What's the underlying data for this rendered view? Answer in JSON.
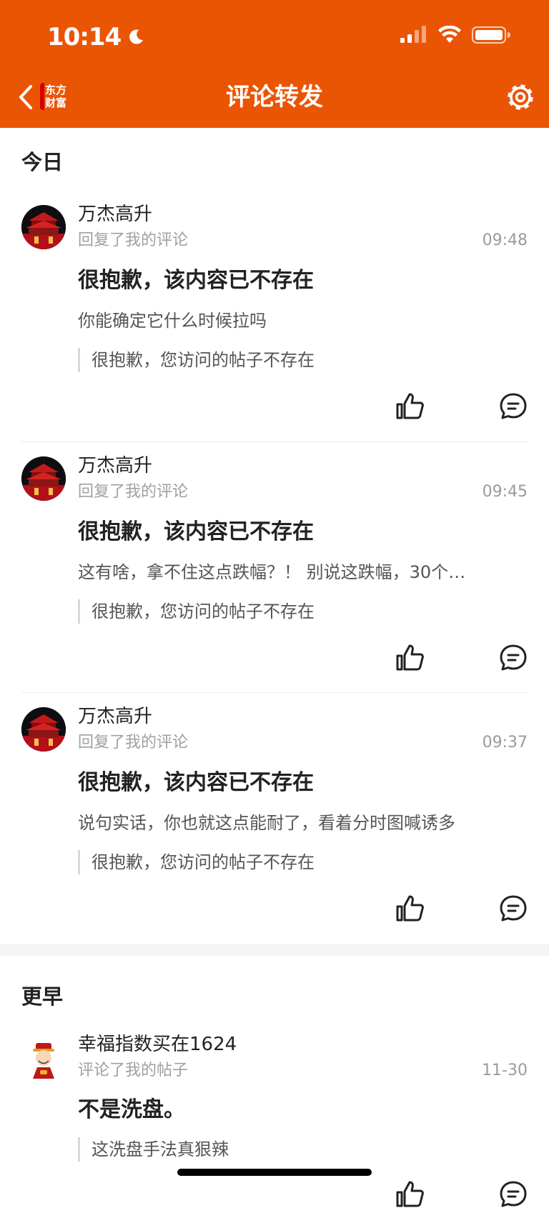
{
  "status_bar": {
    "time": "10:14"
  },
  "nav": {
    "title": "评论转发",
    "logo_line1": "东方",
    "logo_line2": "财富"
  },
  "sections": {
    "today_label": "今日",
    "earlier_label": "更早"
  },
  "today": [
    {
      "username": "万杰高升",
      "action": "回复了我的评论",
      "time": "09:48",
      "headline": "很抱歉，该内容已不存在",
      "reply": "你能确定它什么时候拉吗",
      "quote": "很抱歉，您访问的帖子不存在"
    },
    {
      "username": "万杰高升",
      "action": "回复了我的评论",
      "time": "09:45",
      "headline": "很抱歉，该内容已不存在",
      "reply": "这有啥，拿不住这点跌幅？！ 别说这跌幅，30个…",
      "quote": "很抱歉，您访问的帖子不存在"
    },
    {
      "username": "万杰高升",
      "action": "回复了我的评论",
      "time": "09:37",
      "headline": "很抱歉，该内容已不存在",
      "reply": "说句实话，你也就这点能耐了，看着分时图喊诱多",
      "quote": "很抱歉，您访问的帖子不存在"
    }
  ],
  "earlier": [
    {
      "username": "幸福指数买在1624",
      "action": "评论了我的帖子",
      "time": "11-30",
      "headline": "不是洗盘。",
      "quote": "这洗盘手法真狠辣"
    }
  ],
  "colors": {
    "brand": "#ea5504",
    "secondary_text": "#a0a0a0",
    "quote_bar": "#d8d8d8"
  },
  "icons": [
    "back-chevron-icon",
    "settings-gear-icon",
    "thumbs-up-icon",
    "comment-bubble-icon",
    "moon-icon",
    "signal-icon",
    "wifi-icon",
    "battery-icon"
  ]
}
